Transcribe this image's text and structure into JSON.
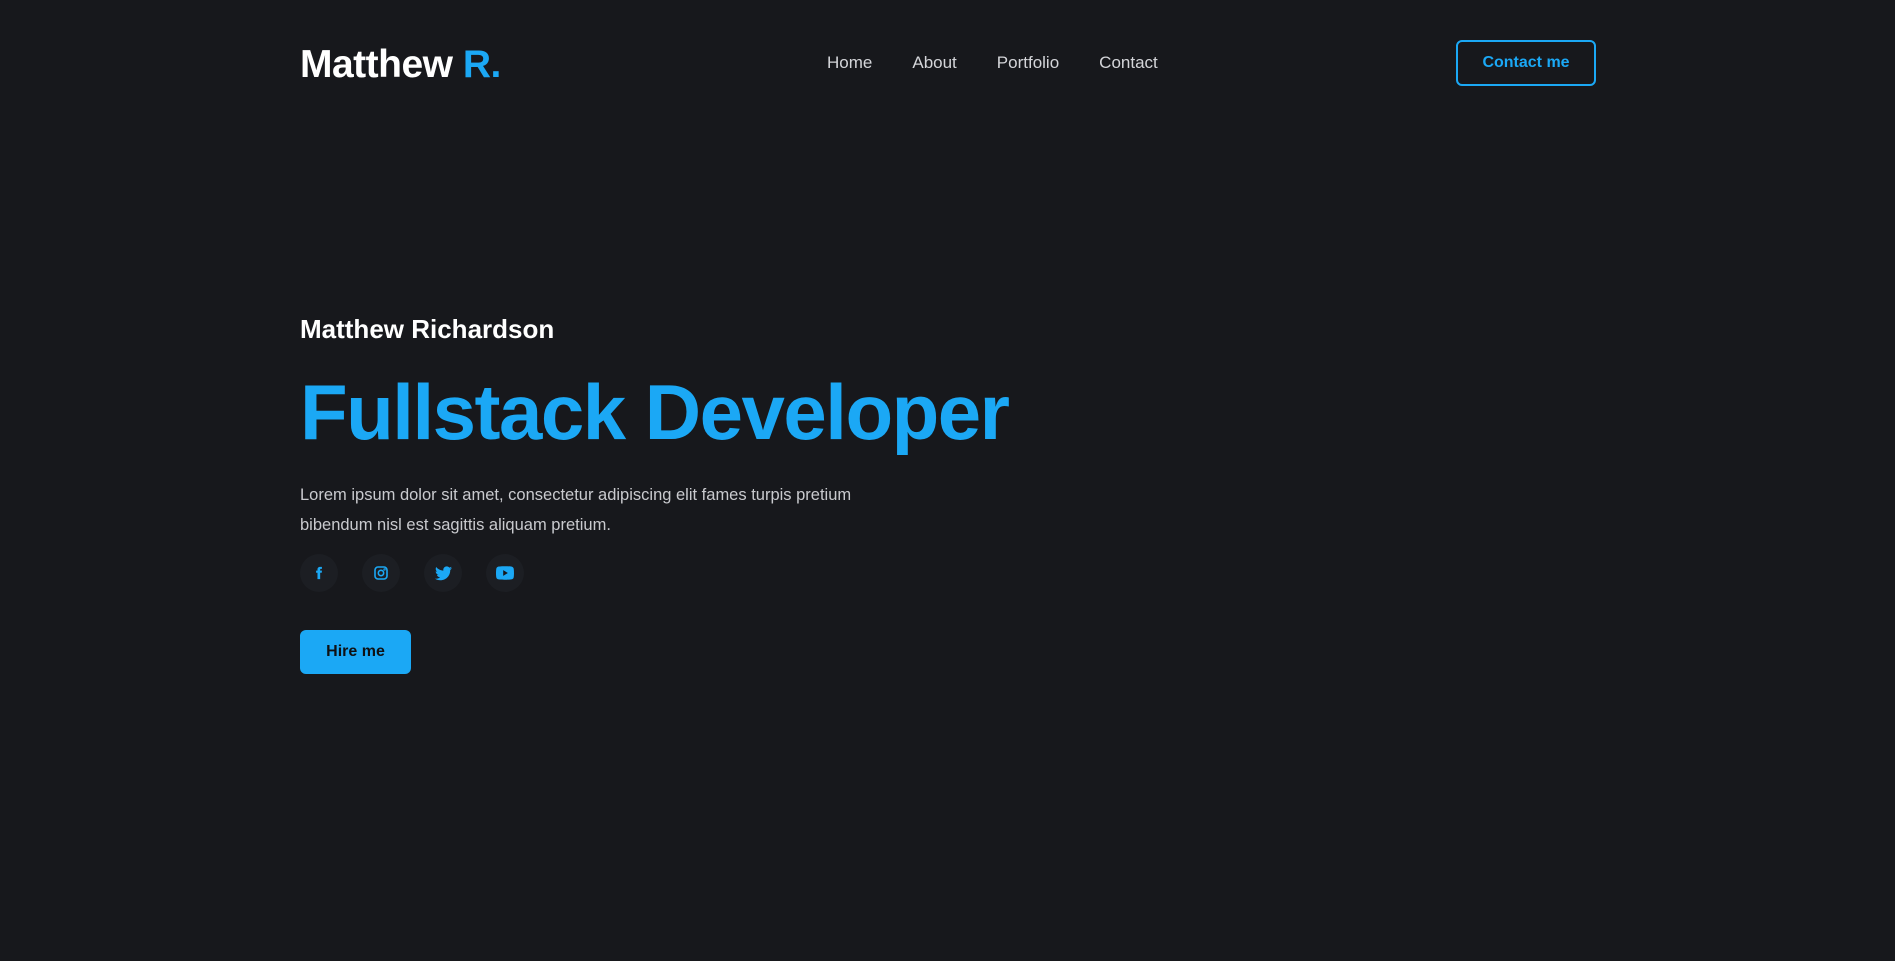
{
  "header": {
    "logo_main": "Matthew",
    "logo_accent": "R.",
    "nav": [
      {
        "label": "Home"
      },
      {
        "label": "About"
      },
      {
        "label": "Portfolio"
      },
      {
        "label": "Contact"
      }
    ],
    "contact_label": "Contact me"
  },
  "hero": {
    "name": "Matthew Richardson",
    "title": "Fullstack Developer",
    "description": "Lorem ipsum dolor sit amet, consectetur adipiscing elit fames turpis pretium bibendum nisl est sagittis aliquam pretium.",
    "socials": [
      {
        "icon": "facebook-icon"
      },
      {
        "icon": "instagram-icon"
      },
      {
        "icon": "twitter-icon"
      },
      {
        "icon": "youtube-icon"
      }
    ],
    "hire_label": "Hire me"
  },
  "colors": {
    "background": "#17181c",
    "accent": "#1ba8f5",
    "text": "#ffffff",
    "muted": "#c9cace"
  }
}
